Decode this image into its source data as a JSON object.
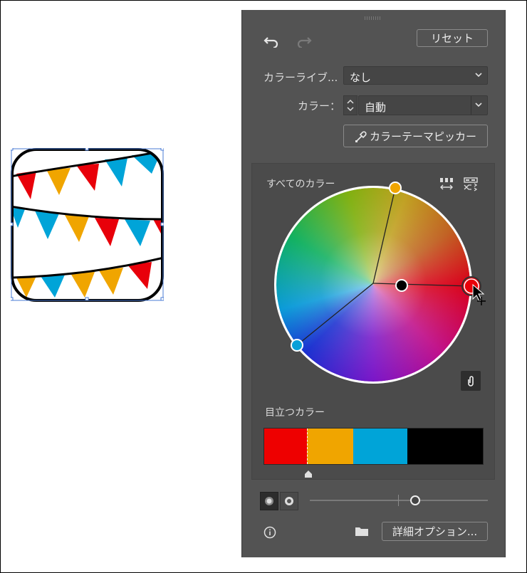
{
  "panel": {
    "reset_label": "リセット",
    "library_label": "カラーライブ...",
    "library_value": "なし",
    "color_label": "カラー：",
    "color_value": "自動",
    "theme_picker_label": "カラーテーマピッカー",
    "all_colors_label": "すべてのカラー",
    "prominent_colors_label": "目立つカラー",
    "advanced_options_label": "詳細オプション...",
    "slider_value": 0.66
  },
  "wheel_handles": [
    {
      "name": "orange",
      "color": "#f0a500"
    },
    {
      "name": "red",
      "color": "#e8000a"
    },
    {
      "name": "blue",
      "color": "#0aa0d8"
    },
    {
      "name": "black",
      "color": "#000000"
    }
  ],
  "swatches": [
    {
      "color": "#ee0000",
      "share": 60
    },
    {
      "color": "#f0a500",
      "share": 65
    },
    {
      "color": "#00a4d8",
      "share": 76
    },
    {
      "color": "#000000",
      "share": 106
    }
  ],
  "artwork_colors": {
    "red": "#e8000a",
    "orange": "#f0a500",
    "blue": "#00a4d8"
  }
}
